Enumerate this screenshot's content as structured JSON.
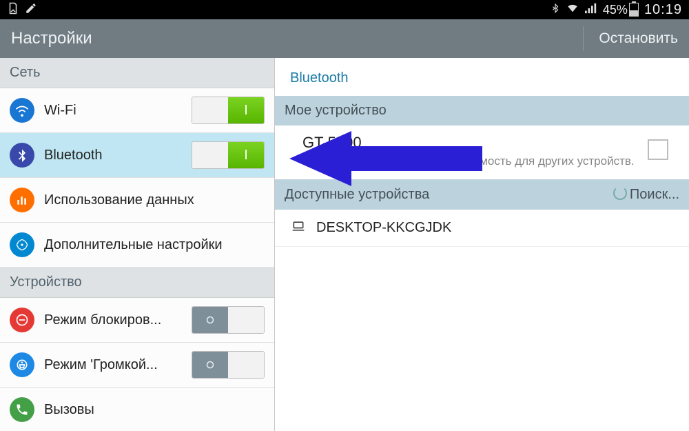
{
  "status": {
    "battery_pct": "45%",
    "time": "10:19"
  },
  "actionbar": {
    "title": "Настройки",
    "stop": "Остановить"
  },
  "sidebar": {
    "sections": [
      {
        "header": "Сеть"
      },
      {
        "header": "Устройство"
      }
    ],
    "items": {
      "wifi": {
        "label": "Wi-Fi",
        "on": true
      },
      "bluetooth": {
        "label": "Bluetooth",
        "on": true
      },
      "data": {
        "label": "Использование данных"
      },
      "more": {
        "label": "Дополнительные настройки"
      },
      "block": {
        "label": "Режим блокиров...",
        "on": false
      },
      "hands": {
        "label": "Режим 'Громкой...",
        "on": false
      },
      "calls": {
        "label": "Вызовы"
      }
    }
  },
  "content": {
    "title": "Bluetooth",
    "my_device_header": "Мое устройство",
    "my_device_name": "GT-5100",
    "my_device_hint": "Выберите, чтобы включить видимость для других устройств.",
    "available_header": "Доступные устройства",
    "search": "Поиск...",
    "devices": [
      {
        "name": "DESKTOP-KKCGJDK",
        "type": "laptop"
      }
    ]
  }
}
